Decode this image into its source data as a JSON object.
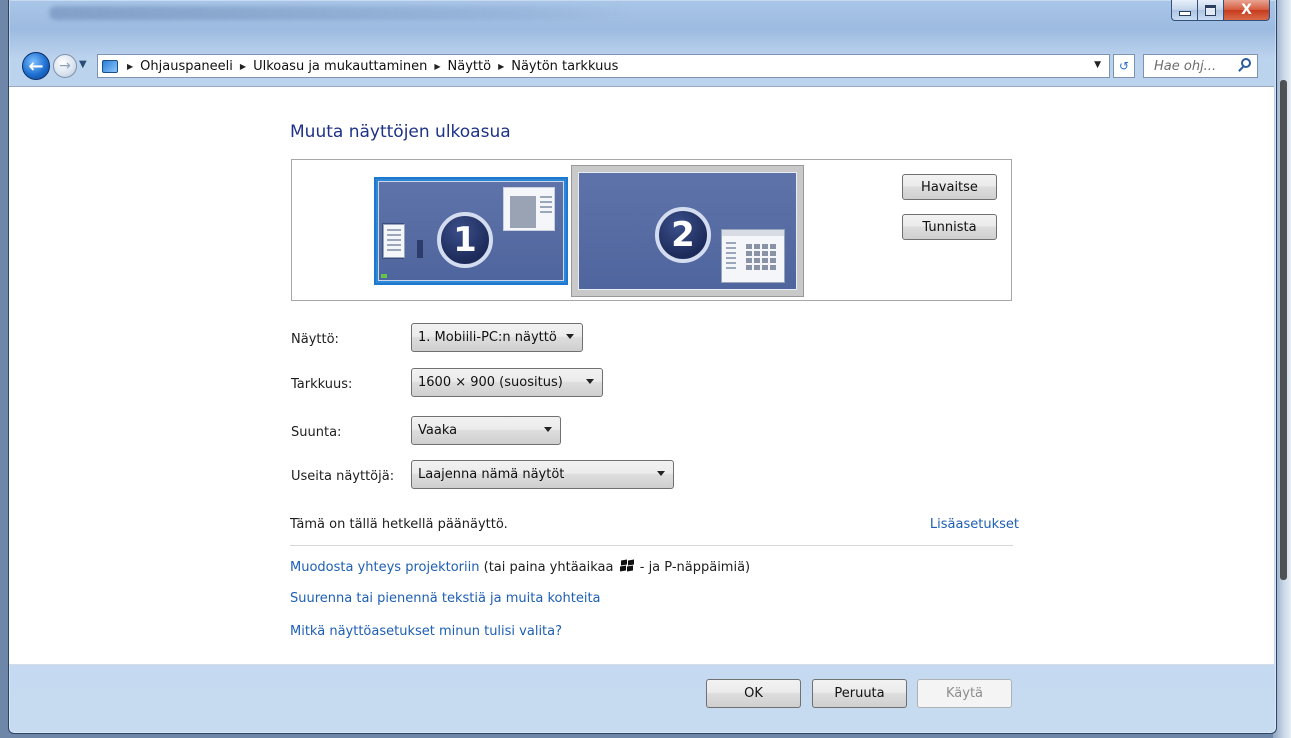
{
  "window": {
    "close_glyph": "X"
  },
  "navigation": {
    "back_glyph": "←",
    "forward_glyph": "→",
    "breadcrumbs": [
      "Ohjauspaneeli",
      "Ulkoasu ja mukauttaminen",
      "Näyttö",
      "Näytön tarkkuus"
    ],
    "search_placeholder": "Hae ohj..."
  },
  "main": {
    "title": "Muuta näyttöjen ulkoasua",
    "monitors": [
      {
        "number": "1",
        "selected": true
      },
      {
        "number": "2",
        "selected": false
      }
    ],
    "detect_label": "Havaitse",
    "identify_label": "Tunnista",
    "fields": {
      "display_label": "Näyttö:",
      "display_value": "1. Mobiili-PC:n näyttö",
      "resolution_label": "Tarkkuus:",
      "resolution_value": "1600 × 900 (suositus)",
      "orientation_label": "Suunta:",
      "orientation_value": "Vaaka",
      "multiple_label": "Useita näyttöjä:",
      "multiple_value": "Laajenna nämä näytöt"
    },
    "status_text": "Tämä on tällä hetkellä päänäyttö.",
    "advanced_link": "Lisäasetukset",
    "links": {
      "projector_link": "Muodosta yhteys projektoriin",
      "projector_hint_pre": " (tai paina yhtäaikaa ",
      "projector_hint_post": " - ja P-näppäimiä)",
      "text_size_link": "Suurenna tai pienennä tekstiä ja muita kohteita",
      "help_link": "Mitkä näyttöasetukset minun tulisi valita?"
    }
  },
  "footer": {
    "ok_label": "OK",
    "cancel_label": "Peruuta",
    "apply_label": "Käytä"
  },
  "colors": {
    "link": "#1e5fb4",
    "title": "#1e3287",
    "selected_monitor": "#2f87d6"
  }
}
